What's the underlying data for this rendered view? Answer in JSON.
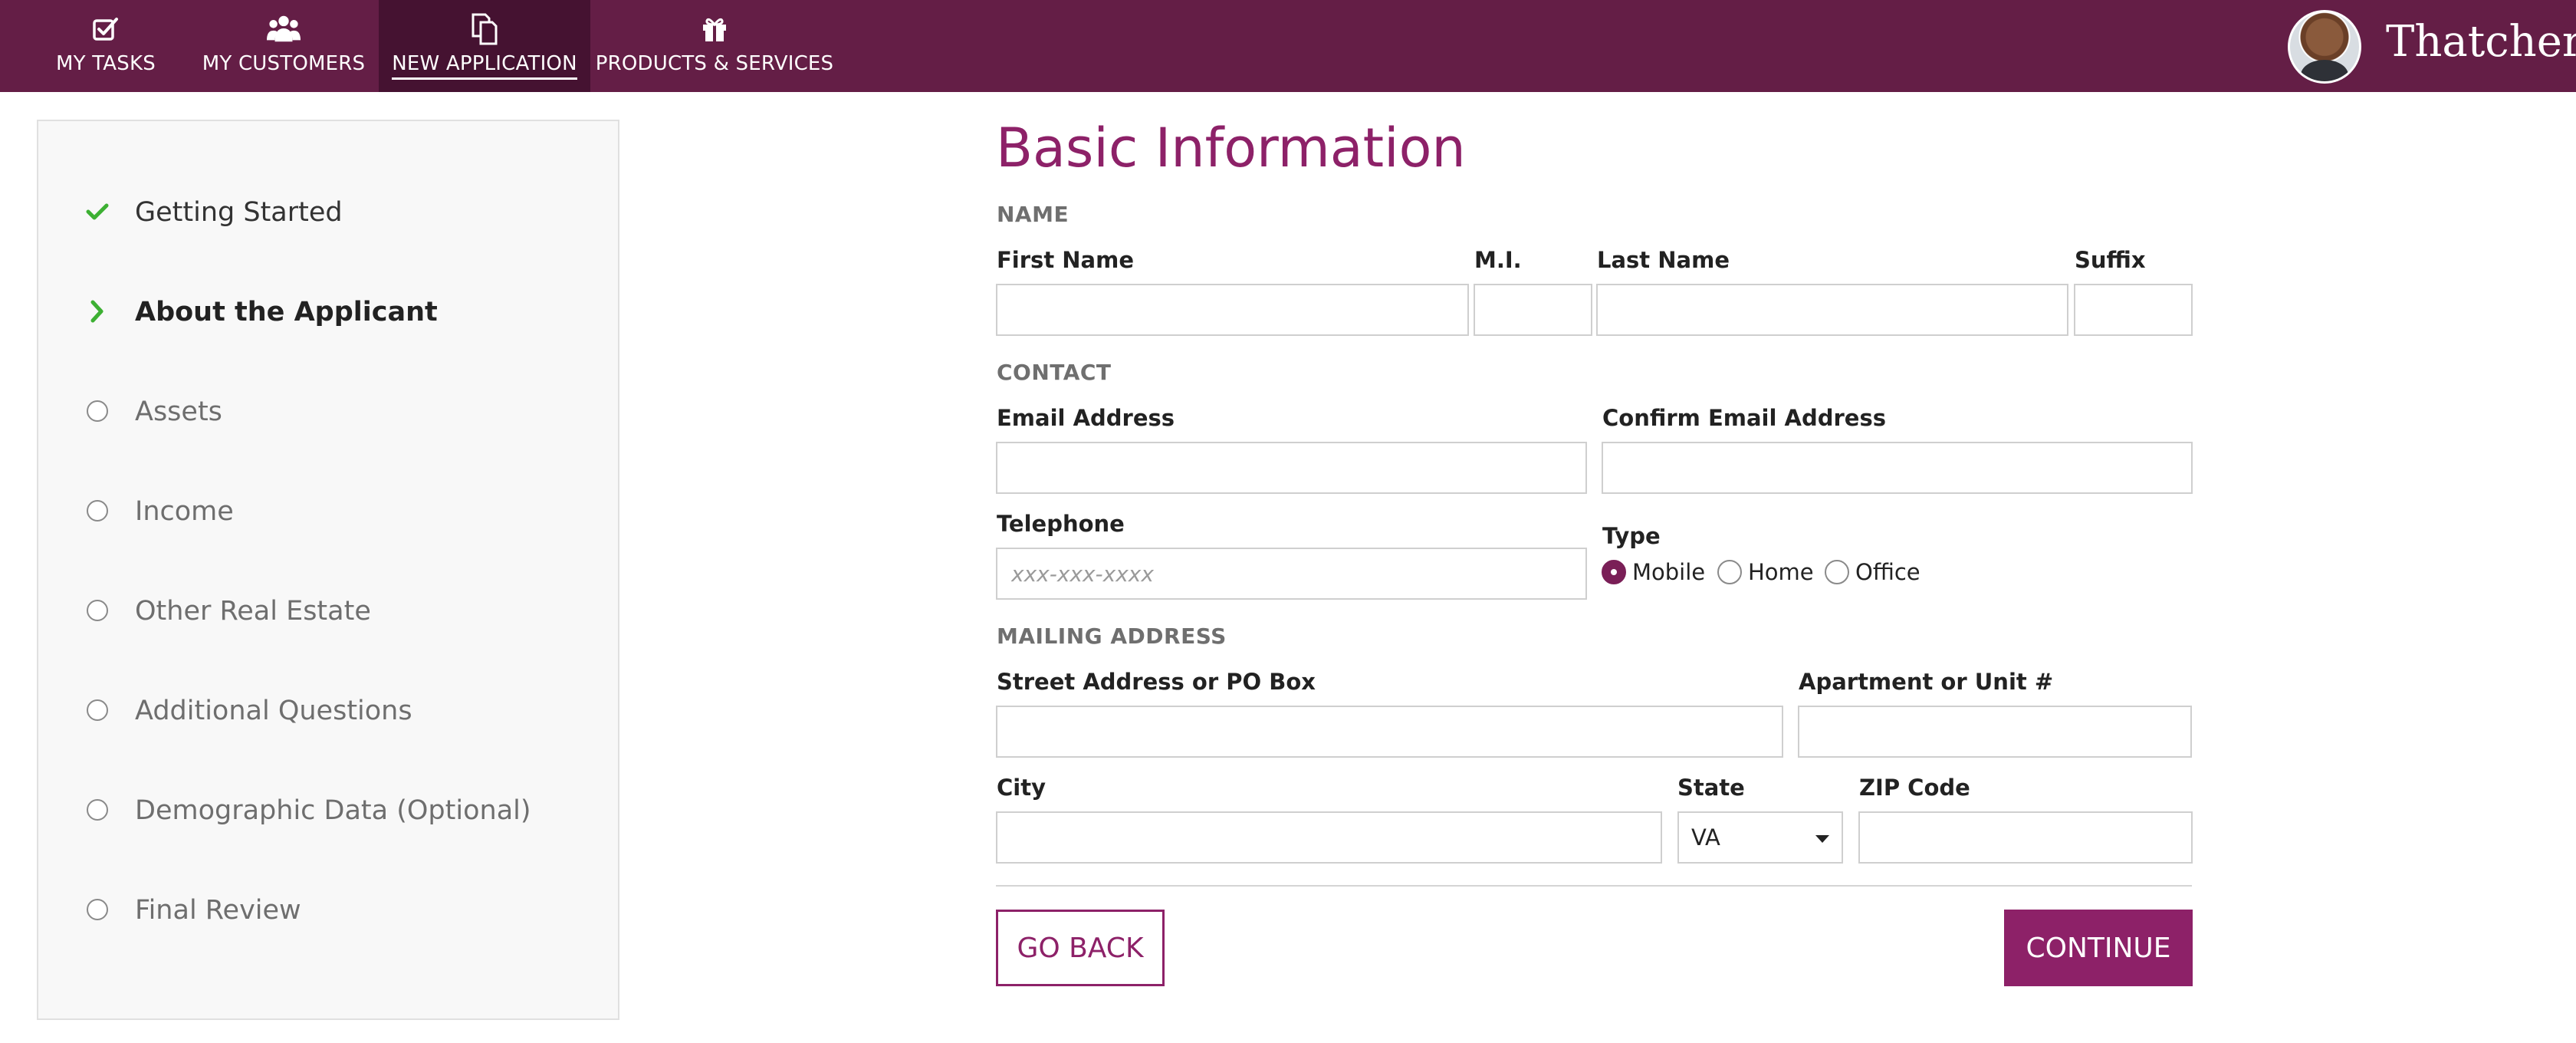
{
  "nav": {
    "items": [
      {
        "label": "MY TASKS",
        "icon": "checkbox-check-icon"
      },
      {
        "label": "MY CUSTOMERS",
        "icon": "users-icon"
      },
      {
        "label": "NEW APPLICATION",
        "icon": "documents-icon",
        "active": true
      },
      {
        "label": "PRODUCTS & SERVICES",
        "icon": "gift-icon"
      }
    ],
    "brand": "Thatcher.",
    "colors": {
      "bar": "#641e46",
      "active": "#451231"
    }
  },
  "sidebar": {
    "steps": [
      {
        "label": "Getting Started",
        "status": "complete",
        "icon": "check-icon"
      },
      {
        "label": "About the Applicant",
        "status": "current",
        "icon": "chevron-right-icon"
      },
      {
        "label": "Assets",
        "status": "pending",
        "icon": "circle-icon"
      },
      {
        "label": "Income",
        "status": "pending",
        "icon": "circle-icon"
      },
      {
        "label": "Other Real Estate",
        "status": "pending",
        "icon": "circle-icon"
      },
      {
        "label": "Additional Questions",
        "status": "pending",
        "icon": "circle-icon"
      },
      {
        "label": "Demographic Data (Optional)",
        "status": "pending",
        "icon": "circle-icon"
      },
      {
        "label": "Final Review",
        "status": "pending",
        "icon": "circle-icon"
      }
    ],
    "colors": {
      "complete": "#3db033"
    }
  },
  "form": {
    "title": "Basic Information",
    "name_section": {
      "heading": "NAME",
      "first_name": {
        "label": "First Name",
        "value": ""
      },
      "mi": {
        "label": "M.I.",
        "value": ""
      },
      "last_name": {
        "label": "Last Name",
        "value": ""
      },
      "suffix": {
        "label": "Suffix",
        "value": ""
      }
    },
    "contact_section": {
      "heading": "CONTACT",
      "email": {
        "label": "Email Address",
        "value": ""
      },
      "confirm_email": {
        "label": "Confirm Email Address",
        "value": ""
      },
      "telephone": {
        "label": "Telephone",
        "value": "",
        "placeholder": "xxx-xxx-xxxx"
      },
      "type": {
        "label": "Type",
        "options": [
          "Mobile",
          "Home",
          "Office"
        ],
        "selected": "Mobile"
      }
    },
    "mailing_section": {
      "heading": "MAILING ADDRESS",
      "street": {
        "label": "Street Address or PO Box",
        "value": ""
      },
      "apartment": {
        "label": "Apartment or Unit #",
        "value": ""
      },
      "city": {
        "label": "City",
        "value": ""
      },
      "state": {
        "label": "State",
        "value": "VA"
      },
      "zip": {
        "label": "ZIP Code",
        "value": ""
      }
    },
    "buttons": {
      "back": "GO BACK",
      "continue": "CONTINUE"
    },
    "colors": {
      "accent": "#8d2168"
    }
  }
}
